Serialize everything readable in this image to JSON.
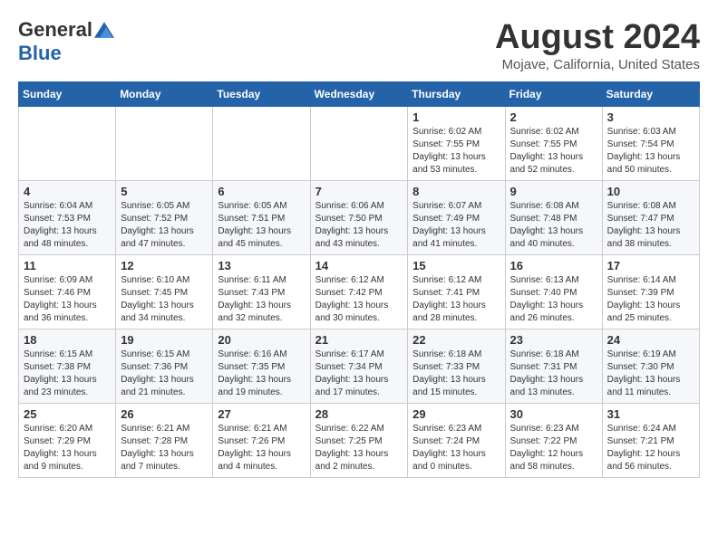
{
  "header": {
    "logo": {
      "general": "General",
      "blue": "Blue"
    },
    "title": "August 2024",
    "location": "Mojave, California, United States"
  },
  "calendar": {
    "days_of_week": [
      "Sunday",
      "Monday",
      "Tuesday",
      "Wednesday",
      "Thursday",
      "Friday",
      "Saturday"
    ],
    "weeks": [
      [
        {
          "day": "",
          "info": ""
        },
        {
          "day": "",
          "info": ""
        },
        {
          "day": "",
          "info": ""
        },
        {
          "day": "",
          "info": ""
        },
        {
          "day": "1",
          "info": "Sunrise: 6:02 AM\nSunset: 7:55 PM\nDaylight: 13 hours\nand 53 minutes."
        },
        {
          "day": "2",
          "info": "Sunrise: 6:02 AM\nSunset: 7:55 PM\nDaylight: 13 hours\nand 52 minutes."
        },
        {
          "day": "3",
          "info": "Sunrise: 6:03 AM\nSunset: 7:54 PM\nDaylight: 13 hours\nand 50 minutes."
        }
      ],
      [
        {
          "day": "4",
          "info": "Sunrise: 6:04 AM\nSunset: 7:53 PM\nDaylight: 13 hours\nand 48 minutes."
        },
        {
          "day": "5",
          "info": "Sunrise: 6:05 AM\nSunset: 7:52 PM\nDaylight: 13 hours\nand 47 minutes."
        },
        {
          "day": "6",
          "info": "Sunrise: 6:05 AM\nSunset: 7:51 PM\nDaylight: 13 hours\nand 45 minutes."
        },
        {
          "day": "7",
          "info": "Sunrise: 6:06 AM\nSunset: 7:50 PM\nDaylight: 13 hours\nand 43 minutes."
        },
        {
          "day": "8",
          "info": "Sunrise: 6:07 AM\nSunset: 7:49 PM\nDaylight: 13 hours\nand 41 minutes."
        },
        {
          "day": "9",
          "info": "Sunrise: 6:08 AM\nSunset: 7:48 PM\nDaylight: 13 hours\nand 40 minutes."
        },
        {
          "day": "10",
          "info": "Sunrise: 6:08 AM\nSunset: 7:47 PM\nDaylight: 13 hours\nand 38 minutes."
        }
      ],
      [
        {
          "day": "11",
          "info": "Sunrise: 6:09 AM\nSunset: 7:46 PM\nDaylight: 13 hours\nand 36 minutes."
        },
        {
          "day": "12",
          "info": "Sunrise: 6:10 AM\nSunset: 7:45 PM\nDaylight: 13 hours\nand 34 minutes."
        },
        {
          "day": "13",
          "info": "Sunrise: 6:11 AM\nSunset: 7:43 PM\nDaylight: 13 hours\nand 32 minutes."
        },
        {
          "day": "14",
          "info": "Sunrise: 6:12 AM\nSunset: 7:42 PM\nDaylight: 13 hours\nand 30 minutes."
        },
        {
          "day": "15",
          "info": "Sunrise: 6:12 AM\nSunset: 7:41 PM\nDaylight: 13 hours\nand 28 minutes."
        },
        {
          "day": "16",
          "info": "Sunrise: 6:13 AM\nSunset: 7:40 PM\nDaylight: 13 hours\nand 26 minutes."
        },
        {
          "day": "17",
          "info": "Sunrise: 6:14 AM\nSunset: 7:39 PM\nDaylight: 13 hours\nand 25 minutes."
        }
      ],
      [
        {
          "day": "18",
          "info": "Sunrise: 6:15 AM\nSunset: 7:38 PM\nDaylight: 13 hours\nand 23 minutes."
        },
        {
          "day": "19",
          "info": "Sunrise: 6:15 AM\nSunset: 7:36 PM\nDaylight: 13 hours\nand 21 minutes."
        },
        {
          "day": "20",
          "info": "Sunrise: 6:16 AM\nSunset: 7:35 PM\nDaylight: 13 hours\nand 19 minutes."
        },
        {
          "day": "21",
          "info": "Sunrise: 6:17 AM\nSunset: 7:34 PM\nDaylight: 13 hours\nand 17 minutes."
        },
        {
          "day": "22",
          "info": "Sunrise: 6:18 AM\nSunset: 7:33 PM\nDaylight: 13 hours\nand 15 minutes."
        },
        {
          "day": "23",
          "info": "Sunrise: 6:18 AM\nSunset: 7:31 PM\nDaylight: 13 hours\nand 13 minutes."
        },
        {
          "day": "24",
          "info": "Sunrise: 6:19 AM\nSunset: 7:30 PM\nDaylight: 13 hours\nand 11 minutes."
        }
      ],
      [
        {
          "day": "25",
          "info": "Sunrise: 6:20 AM\nSunset: 7:29 PM\nDaylight: 13 hours\nand 9 minutes."
        },
        {
          "day": "26",
          "info": "Sunrise: 6:21 AM\nSunset: 7:28 PM\nDaylight: 13 hours\nand 7 minutes."
        },
        {
          "day": "27",
          "info": "Sunrise: 6:21 AM\nSunset: 7:26 PM\nDaylight: 13 hours\nand 4 minutes."
        },
        {
          "day": "28",
          "info": "Sunrise: 6:22 AM\nSunset: 7:25 PM\nDaylight: 13 hours\nand 2 minutes."
        },
        {
          "day": "29",
          "info": "Sunrise: 6:23 AM\nSunset: 7:24 PM\nDaylight: 13 hours\nand 0 minutes."
        },
        {
          "day": "30",
          "info": "Sunrise: 6:23 AM\nSunset: 7:22 PM\nDaylight: 12 hours\nand 58 minutes."
        },
        {
          "day": "31",
          "info": "Sunrise: 6:24 AM\nSunset: 7:21 PM\nDaylight: 12 hours\nand 56 minutes."
        }
      ]
    ]
  }
}
